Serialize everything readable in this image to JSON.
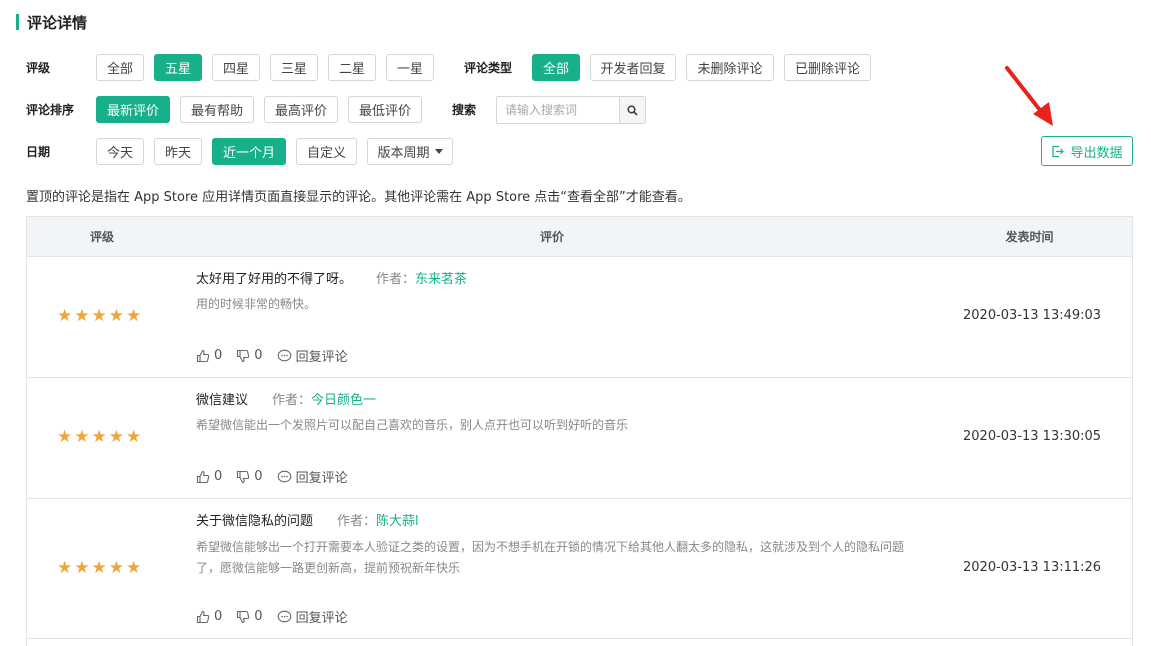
{
  "page": {
    "title": "评论详情"
  },
  "filters": {
    "rating": {
      "label": "评级",
      "options": [
        "全部",
        "五星",
        "四星",
        "三星",
        "二星",
        "一星"
      ],
      "selected": "五星"
    },
    "type": {
      "label": "评论类型",
      "options": [
        "全部",
        "开发者回复",
        "未删除评论",
        "已删除评论"
      ],
      "selected": "全部"
    },
    "sort": {
      "label": "评论排序",
      "options": [
        "最新评价",
        "最有帮助",
        "最高评价",
        "最低评价"
      ],
      "selected": "最新评价"
    },
    "search": {
      "label": "搜索",
      "placeholder": "请输入搜索词",
      "value": ""
    },
    "date": {
      "label": "日期",
      "options": [
        "今天",
        "昨天",
        "近一个月",
        "自定义"
      ],
      "selected": "近一个月",
      "dropdown_label": "版本周期"
    }
  },
  "export": {
    "label": "导出数据"
  },
  "notice": "置顶的评论是指在 App Store 应用详情页面直接显示的评论。其他评论需在 App Store 点击“查看全部”才能查看。",
  "table": {
    "headers": {
      "rating": "评级",
      "review": "评价",
      "time": "发表时间"
    },
    "author_prefix": "作者：",
    "reply_label": "回复评论",
    "rows": [
      {
        "stars": "★★★★★",
        "title": "太好用了好用的不得了呀。",
        "author": "东来茗茶",
        "body": "用的时候非常的畅快。",
        "likes": "0",
        "dislikes": "0",
        "time": "2020-03-13 13:49:03"
      },
      {
        "stars": "★★★★★",
        "title": "微信建议",
        "author": "今日颜色一",
        "body": "希望微信能出一个发照片可以配自己喜欢的音乐，别人点开也可以听到好听的音乐",
        "likes": "0",
        "dislikes": "0",
        "time": "2020-03-13 13:30:05"
      },
      {
        "stars": "★★★★★",
        "title": "关于微信隐私的问题",
        "author": "陈大蒜l",
        "body": "希望微信能够出一个打开需要本人验证之类的设置，因为不想手机在开锁的情况下给其他人翻太多的隐私，这就涉及到个人的隐私问题了，愿微信能够一路更创新高，提前预祝新年快乐",
        "likes": "0",
        "dislikes": "0",
        "time": "2020-03-13 13:11:26"
      }
    ]
  },
  "colors": {
    "accent": "#18b08a",
    "star": "#f0a43a",
    "arrow": "#e8231c"
  }
}
